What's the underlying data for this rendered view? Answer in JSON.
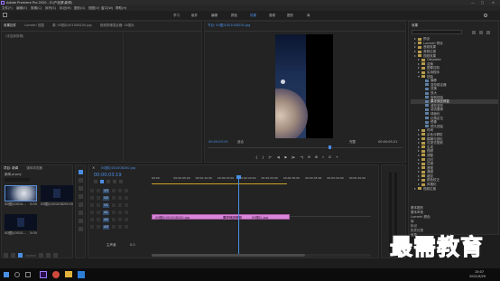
{
  "titlebar": {
    "title": "Adobe Premiere Pro 2020 - D:\\产品原\\新闻\\",
    "controls": [
      "—",
      "□",
      "✕"
    ]
  },
  "menu": [
    "文件(F)",
    "编辑(E)",
    "剪辑(C)",
    "序列(S)",
    "标记(M)",
    "图形(G)",
    "视图(V)",
    "窗口(W)",
    "帮助(H)"
  ],
  "workspaces": [
    "学习",
    "组件",
    "编辑",
    "颜色",
    "效果",
    "音频",
    "图形",
    "库"
  ],
  "active_workspace": "效果",
  "source_panel": {
    "tabs": [
      "效果控件",
      "Lumetri 范围",
      "源: 00图片001008200.jpg",
      "音频剪辑混合器: 00图片"
    ],
    "no_clip": "(未选择剪辑)"
  },
  "program": {
    "tab": "节目: 00图片001008200.jpg",
    "timecode_left": "00:00:03:19",
    "fit": "适合",
    "quality": "完整",
    "timecode_right": "00:00:05:21",
    "transport": [
      "{",
      "}",
      "|←",
      "◄|",
      "▶",
      "|►",
      "→|",
      "⊟",
      "⊞",
      "⌗",
      "⊡",
      "+"
    ]
  },
  "effects": {
    "title": "效果",
    "search_placeholder": "",
    "items": [
      {
        "label": "预设",
        "indent": 1,
        "kind": "folder"
      },
      {
        "label": "Lumetri 预设",
        "indent": 1,
        "kind": "folder"
      },
      {
        "label": "音频效果",
        "indent": 1,
        "kind": "folder"
      },
      {
        "label": "音频过渡",
        "indent": 1,
        "kind": "folder"
      },
      {
        "label": "视频效果",
        "indent": 1,
        "kind": "folder"
      },
      {
        "label": "Obsolete",
        "indent": 2,
        "kind": "folder"
      },
      {
        "label": "变换",
        "indent": 2,
        "kind": "folder"
      },
      {
        "label": "图像控制",
        "indent": 2,
        "kind": "folder"
      },
      {
        "label": "实用程序",
        "indent": 2,
        "kind": "folder"
      },
      {
        "label": "扭曲",
        "indent": 2,
        "kind": "folder-open"
      },
      {
        "label": "偏移",
        "indent": 3,
        "kind": "fx"
      },
      {
        "label": "变形稳定器",
        "indent": 3,
        "kind": "fx"
      },
      {
        "label": "变换",
        "indent": 3,
        "kind": "fx"
      },
      {
        "label": "放大",
        "indent": 3,
        "kind": "fx"
      },
      {
        "label": "旋转扭曲",
        "indent": 3,
        "kind": "fx"
      },
      {
        "label": "果冻效应修复",
        "indent": 3,
        "kind": "fx",
        "selected": true
      },
      {
        "label": "波形变形",
        "indent": 3,
        "kind": "fx"
      },
      {
        "label": "湍流置换",
        "indent": 3,
        "kind": "fx"
      },
      {
        "label": "球面化",
        "indent": 3,
        "kind": "fx"
      },
      {
        "label": "边角定位",
        "indent": 3,
        "kind": "fx"
      },
      {
        "label": "镜像",
        "indent": 3,
        "kind": "fx"
      },
      {
        "label": "镜头扭曲",
        "indent": 3,
        "kind": "fx"
      },
      {
        "label": "时间",
        "indent": 2,
        "kind": "folder"
      },
      {
        "label": "杂色与颗粒",
        "indent": 2,
        "kind": "folder"
      },
      {
        "label": "模糊与锐化",
        "indent": 2,
        "kind": "folder"
      },
      {
        "label": "沉浸式视频",
        "indent": 2,
        "kind": "folder"
      },
      {
        "label": "生成",
        "indent": 2,
        "kind": "folder"
      },
      {
        "label": "视频",
        "indent": 2,
        "kind": "folder"
      },
      {
        "label": "调整",
        "indent": 2,
        "kind": "folder"
      },
      {
        "label": "过时",
        "indent": 2,
        "kind": "folder"
      },
      {
        "label": "过渡",
        "indent": 2,
        "kind": "folder"
      },
      {
        "label": "透视",
        "indent": 2,
        "kind": "folder"
      },
      {
        "label": "通道",
        "indent": 2,
        "kind": "folder"
      },
      {
        "label": "键控",
        "indent": 2,
        "kind": "folder"
      },
      {
        "label": "颜色校正",
        "indent": 2,
        "kind": "folder"
      },
      {
        "label": "风格化",
        "indent": 2,
        "kind": "folder"
      },
      {
        "label": "视频过渡",
        "indent": 1,
        "kind": "folder"
      }
    ],
    "bottom_sections": [
      "基本图形",
      "基本声音",
      "Lumetri 颜色",
      "库",
      "标记",
      "历史记录",
      "信息"
    ]
  },
  "project": {
    "tabs": [
      "项目: 新闻",
      "媒体浏览器"
    ],
    "file": "新闻.prproj",
    "items": [
      {
        "label": "00图片0010...",
        "duration": "5:00"
      },
      {
        "label": "00图片001008200.jpg",
        "duration": "5:00"
      },
      {
        "label": "00图片0010...",
        "duration": "5:00"
      }
    ]
  },
  "timeline": {
    "tab": "00图片001008200.jpg",
    "timecode": "00:00:03:19",
    "ruler": [
      "00:00",
      "00:00:05:00",
      "00:00:10:00",
      "00:00:15:00",
      "00:00:20:00",
      "00:00:25:00",
      "00:00:30:00",
      "00:00:35:00",
      "00:00:40:00",
      "00:00:45:00"
    ],
    "tracks": [
      "V3",
      "V2",
      "V1",
      "A1",
      "A2",
      "A3"
    ],
    "master": "主声道",
    "master_value": "0.0",
    "clips": [
      {
        "label": "00图片001008200.jpg",
        "track": "V1"
      },
      {
        "label": "果冻效应修复",
        "track": "V1"
      },
      {
        "label": "00图片.jpg",
        "track": "V1"
      }
    ]
  },
  "watermark": "最需教育",
  "taskbar": {
    "time": "15:07",
    "date": "2021/9/29"
  }
}
